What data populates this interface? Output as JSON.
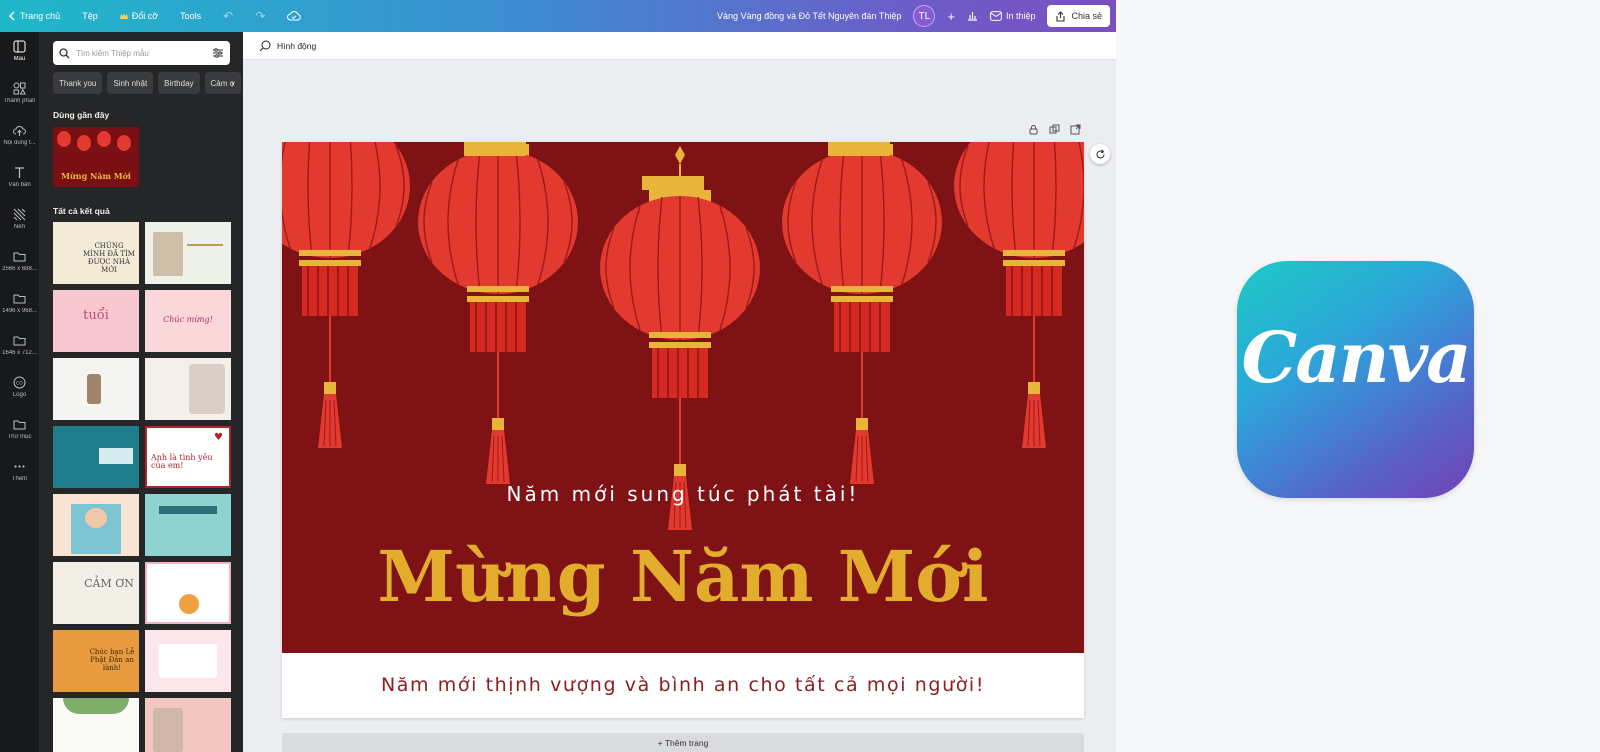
{
  "topbar": {
    "home": "Trang chủ",
    "file": "Tệp",
    "resize": "Đổi cỡ",
    "tools": "Tools",
    "doc_title": "Vàng Vàng đồng và Đỏ Tết Nguyên đán Thiệp",
    "avatar_initials": "TL",
    "print": "In thiệp",
    "share": "Chia sẻ",
    "colors": {
      "gradient_start": "#1fb8c9",
      "gradient_end": "#7a4fc0"
    }
  },
  "rail": {
    "items": [
      {
        "label": "Mẫu",
        "icon": "template-icon"
      },
      {
        "label": "Thành phần",
        "icon": "elements-icon"
      },
      {
        "label": "Nội dung t...",
        "icon": "upload-icon"
      },
      {
        "label": "Văn bản",
        "icon": "text-icon"
      },
      {
        "label": "Nền",
        "icon": "background-icon"
      },
      {
        "label": "2566 x 688...",
        "icon": "folder-icon"
      },
      {
        "label": "1496 x 968...",
        "icon": "folder-icon"
      },
      {
        "label": "1646 x 712...",
        "icon": "folder-icon"
      },
      {
        "label": "Logo",
        "icon": "logo-icon"
      },
      {
        "label": "Thư mục",
        "icon": "folder-icon"
      },
      {
        "label": "Thêm",
        "icon": "more-icon"
      }
    ]
  },
  "panel": {
    "search_placeholder": "Tìm kiếm Thiệp mẫu",
    "chips": [
      "Thank you",
      "Sinh nhật",
      "Birthday",
      "Cảm ơ"
    ],
    "recent_title": "Dùng gần đây",
    "recent_thumb_text": "Mừng Năm Mới",
    "all_results_title": "Tất cả kết quả",
    "thumbs": [
      {
        "text": "CHÚNG MÌNH ĐÃ TÌM ĐƯỢC NHÀ MỚI"
      },
      {
        "text": ""
      },
      {
        "text": "tuổi"
      },
      {
        "text": "Chúc mừng!"
      },
      {
        "text": ""
      },
      {
        "text": ""
      },
      {
        "text": ""
      },
      {
        "text": "Anh là tình yêu của em!"
      },
      {
        "text": ""
      },
      {
        "text": ""
      },
      {
        "text": "CẢM ƠN"
      },
      {
        "text": ""
      },
      {
        "text": "Chúc bạn Lễ Phật Đản an lành!"
      },
      {
        "text": ""
      },
      {
        "text": ""
      },
      {
        "text": ""
      }
    ]
  },
  "subbar": {
    "animate": "Hình động"
  },
  "card": {
    "wish_top": "Năm mới sung túc phát tài!",
    "headline": "Mừng Năm Mới",
    "wish_bottom": "Năm mới thịnh vượng và bình an cho tất cả mọi người!",
    "colors": {
      "background": "#7e1215",
      "headline": "#e2ad2c",
      "lantern": "#e23a2e"
    }
  },
  "add_page": "+ Thêm trang",
  "logo": {
    "text": "Canva"
  }
}
